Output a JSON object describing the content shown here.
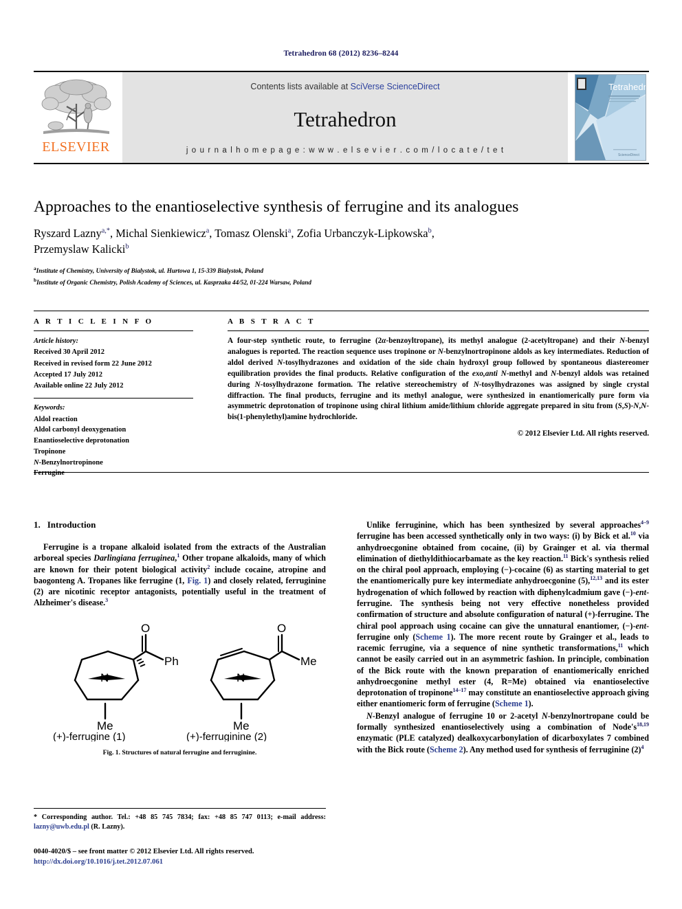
{
  "running_head": "Tetrahedron 68 (2012) 8236–8244",
  "masthead": {
    "publisher_name": "ELSEVIER",
    "contents_prefix": "Contents lists available at ",
    "contents_link": "SciVerse ScienceDirect",
    "journal_name": "Tetrahedron",
    "homepage": "j o u r n a l   h o m e p a g e :   w w w . e l s e v i e r . c o m / l o c a t e / t e t",
    "cover_title": "Tetrahedron",
    "cover_footer": "ScienceDirect"
  },
  "article": {
    "title": "Approaches to the enantioselective synthesis of ferrugine and its analogues",
    "authors_line1": "Ryszard Lazny <sup>a,</sup><sup>*</sup>, Michal Sienkiewicz <sup>a</sup>, Tomasz Olenski <sup>a</sup>, Zofia Urbanczyk-Lipkowska <sup>b</sup>,",
    "authors_line2": "Przemyslaw Kalicki <sup>b</sup>",
    "affiliation_a": "Institute of Chemistry, University of Bialystok, ul. Hurtowa 1, 15-339 Bialystok, Poland",
    "affiliation_b": "Institute of Organic Chemistry, Polish Academy of Sciences, ul. Kasprzaka 44/52, 01-224 Warsaw, Poland"
  },
  "article_info": {
    "label": "A R T I C L E   I N F O",
    "history_heading": "Article history:",
    "history": [
      "Received 30 April 2012",
      "Received in revised form 22 June 2012",
      "Accepted 17 July 2012",
      "Available online 22 July 2012"
    ],
    "keywords_heading": "Keywords:",
    "keywords": [
      "Aldol reaction",
      "Aldol carbonyl deoxygenation",
      "Enantioselective deprotonation",
      "Tropinone",
      "N-Benzylnortropinone",
      "Ferrugine"
    ]
  },
  "abstract": {
    "label": "A B S T R A C T",
    "text": "A four-step synthetic route, to ferrugine (2α-benzoyltropane), its methyl analogue (2-acetyltropane) and their N-benzyl analogues is reported. The reaction sequence uses tropinone or N-benzylnortropinone aldols as key intermediates. Reduction of aldol derived N-tosylhydrazones and oxidation of the side chain hydroxyl group followed by spontaneous diastereomer equilibration provides the final products. Relative configuration of the exo,anti N-methyl and N-benzyl aldols was retained during N-tosylhydrazone formation. The relative stereochemistry of N-tosylhydrazones was assigned by single crystal diffraction. The final products, ferrugine and its methyl analogue, were synthesized in enantiomerically pure form via asymmetric deprotonation of tropinone using chiral lithium amide/lithium chloride aggregate prepared in situ from (S,S)-N,N-bis(1-phenylethyl)amine hydrochloride.",
    "copyright": "© 2012 Elsevier Ltd. All rights reserved."
  },
  "sections": {
    "intro_number": "1.",
    "intro_title": "Introduction",
    "intro_p1": "Ferrugine is a tropane alkaloid isolated from the extracts of the Australian arboreal species Darlingiana ferruginea.1 Other tropane alkaloids, many of which are known for their potent biological activity2 include cocaine, atropine and baogonteng A. Tropanes like ferrugine (1, Fig. 1) and closely related, ferruginine (2) are nicotinic receptor antagonists, potentially useful in the treatment of Alzheimer's disease.3",
    "right_p1": "Unlike ferruginine, which has been synthesized by several approaches4–9 ferrugine has been accessed synthetically only in two ways: (i) by Bick et al.10 via anhydroecgonine obtained from cocaine, (ii) by Grainger et al. via thermal elimination of diethyldithiocarbamate as the key reaction.11 Bick's synthesis relied on the chiral pool approach, employing (−)-cocaine (6) as starting material to get the enantiomerically pure key intermediate anhydroecgonine (5),12,13 and its ester hydrogenation of which followed by reaction with diphenylcadmium gave (−)-ent-ferrugine. The synthesis being not very effective nonetheless provided confirmation of structure and absolute configuration of natural (+)-ferrugine. The chiral pool approach using cocaine can give the unnatural enantiomer, (−)-ent-ferrugine only (Scheme 1). The more recent route by Grainger et al., leads to racemic ferrugine, via a sequence of nine synthetic transformations,11 which cannot be easily carried out in an asymmetric fashion. In principle, combination of the Bick route with the known preparation of enantiomerically enriched anhydroecgonine methyl ester (4, R=Me) obtained via enantioselective deprotonation of tropinone14–17 may constitute an enantioselective approach giving either enantiomeric form of ferrugine (Scheme 1).",
    "right_p2": "N-Benzyl analogue of ferrugine 10 or 2-acetyl N-benzylnortropane could be formally synthesized enantioselectively using a combination of Node's18,19 enzymatic (PLE catalyzed) dealkoxycarbonylation of dicarboxylates 7 combined with the Bick route (Scheme 2). Any method used for synthesis of ferruginine (2)4"
  },
  "figure1": {
    "label_left": "(+)-ferrugine (1)",
    "label_right": "(+)-ferruginine (2)",
    "atom_n": "N",
    "atom_me": "Me",
    "atom_ph": "Ph",
    "atom_o": "O",
    "caption_bold": "Fig. 1.",
    "caption_text": "Structures of natural ferrugine and ferruginine."
  },
  "footnote": {
    "star": "*",
    "text_before_email": " Corresponding author. Tel.: +48 85 745 7834; fax: +48 85 747 0113; e-mail address: ",
    "email": "lazny@uwb.edu.pl",
    "text_after_email": " (R. Lazny)."
  },
  "footer": {
    "issn_line": "0040-4020/$ – see front matter © 2012 Elsevier Ltd. All rights reserved.",
    "doi_line": "http://dx.doi.org/10.1016/j.tet.2012.07.061"
  },
  "colors": {
    "link_blue": "#2c3e8f",
    "elsevier_orange": "#F27021",
    "band_gray": "#e3e3e3"
  }
}
